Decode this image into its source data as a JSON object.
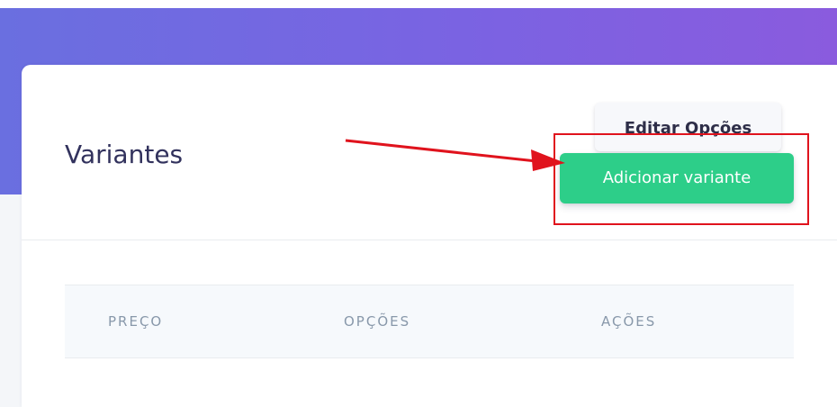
{
  "card": {
    "title": "Variantes",
    "actions": {
      "edit_options_label": "Editar Opções",
      "add_variant_label": "Adicionar variante"
    }
  },
  "table": {
    "columns": [
      "PREÇO",
      "OPÇÕES",
      "AÇÕES"
    ]
  },
  "colors": {
    "header_gradient_start": "#6a6fe0",
    "header_gradient_end": "#8a5bde",
    "primary_button": "#2dce89",
    "annotation": "#e0131d",
    "title_text": "#32325d",
    "column_header_text": "#8898aa"
  }
}
